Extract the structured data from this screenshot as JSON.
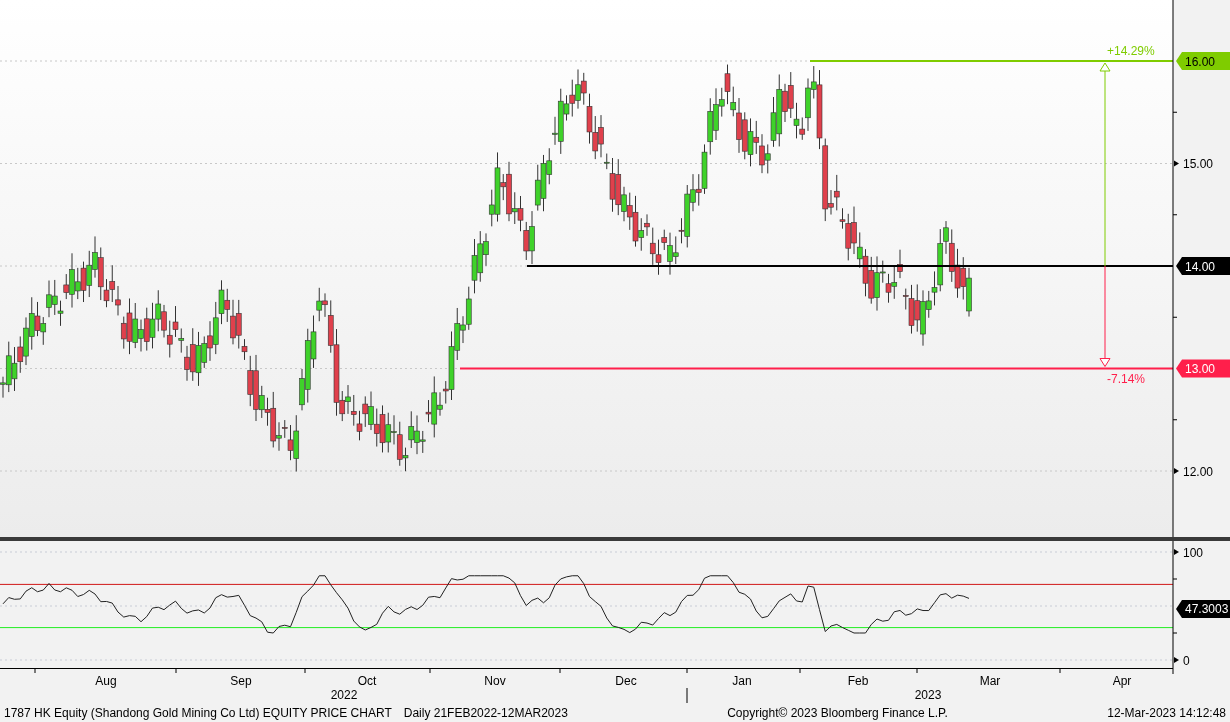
{
  "price_panel": {
    "ticks": [
      "15.00",
      "12.00"
    ],
    "levels": [
      {
        "kind": "target",
        "label": "16.00",
        "color": "#7fcc00"
      },
      {
        "kind": "base",
        "label": "14.00",
        "color": "#000000"
      },
      {
        "kind": "stop",
        "label": "13.00",
        "color": "#ff1f4b"
      }
    ],
    "changes": [
      {
        "kind": "up",
        "text": "+14.29%"
      },
      {
        "kind": "down",
        "text": "-7.14%"
      }
    ]
  },
  "indicator_panel": {
    "ticks": [
      "100",
      "0"
    ],
    "last": "47.3003"
  },
  "x_axis": {
    "months": [
      "Aug",
      "Sep",
      "Oct",
      "Nov",
      "Dec",
      "Jan",
      "Feb",
      "Mar",
      "Apr"
    ],
    "years": [
      "2022",
      "2023"
    ]
  },
  "footer": {
    "security": "1787 HK Equity (Shandong Gold Mining Co Ltd) EQUITY PRICE CHART",
    "range": "Daily 21FEB2022-12MAR2023",
    "copyright": "Copyright© 2023 Bloomberg Finance L.P.",
    "timestamp": "12-Mar-2023 14:12:48"
  }
}
